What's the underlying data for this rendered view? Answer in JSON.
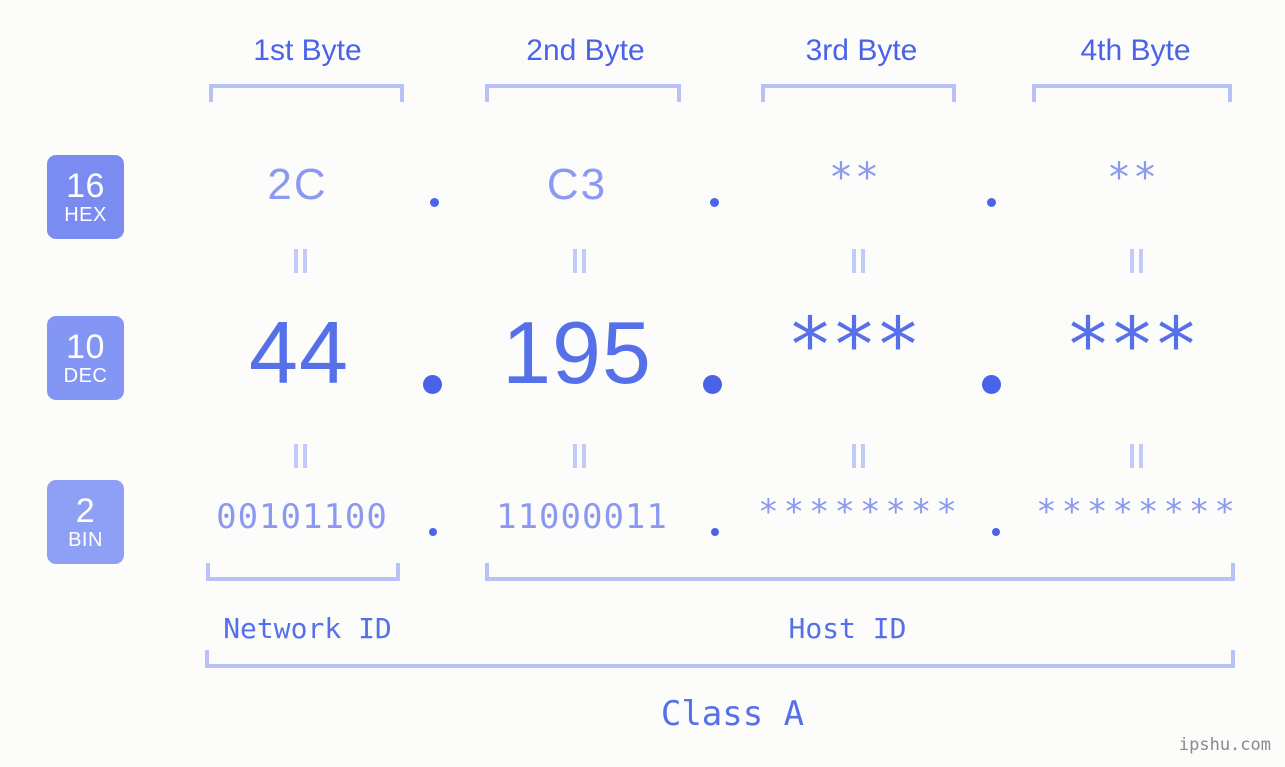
{
  "header": {
    "byte_labels": [
      "1st Byte",
      "2nd Byte",
      "3rd Byte",
      "4th Byte"
    ]
  },
  "bases": [
    {
      "number": "16",
      "name": "HEX",
      "color": "#7b8cf0"
    },
    {
      "number": "10",
      "name": "DEC",
      "color": "#8496f3"
    },
    {
      "number": "2",
      "name": "BIN",
      "color": "#8da0f5"
    }
  ],
  "rows": {
    "hex": {
      "base_number": "16",
      "base_name": "HEX",
      "values": [
        "2C",
        "C3",
        "**",
        "**"
      ],
      "separators": [
        ".",
        ".",
        "."
      ]
    },
    "dec": {
      "base_number": "10",
      "base_name": "DEC",
      "values": [
        "44",
        "195",
        "***",
        "***"
      ],
      "separators": [
        ".",
        ".",
        "."
      ]
    },
    "bin": {
      "base_number": "2",
      "base_name": "BIN",
      "values": [
        "00101100",
        "11000011",
        "********",
        "********"
      ],
      "separators": [
        ".",
        ".",
        "."
      ]
    }
  },
  "equality_marks": {
    "symbol": "||",
    "count_per_row": 4
  },
  "footer": {
    "network_id_label": "Network ID",
    "host_id_label": "Host ID",
    "class_label": "Class A"
  },
  "watermark": "ipshu.com",
  "colors": {
    "background": "#fcfdfa",
    "header_text": "#4a63e8",
    "dec_text": "#5570e8",
    "muted_text": "#8b9af0",
    "bracket": "#b9c2f7",
    "equality": "#c2caf8",
    "watermark": "#8a8a8a"
  }
}
